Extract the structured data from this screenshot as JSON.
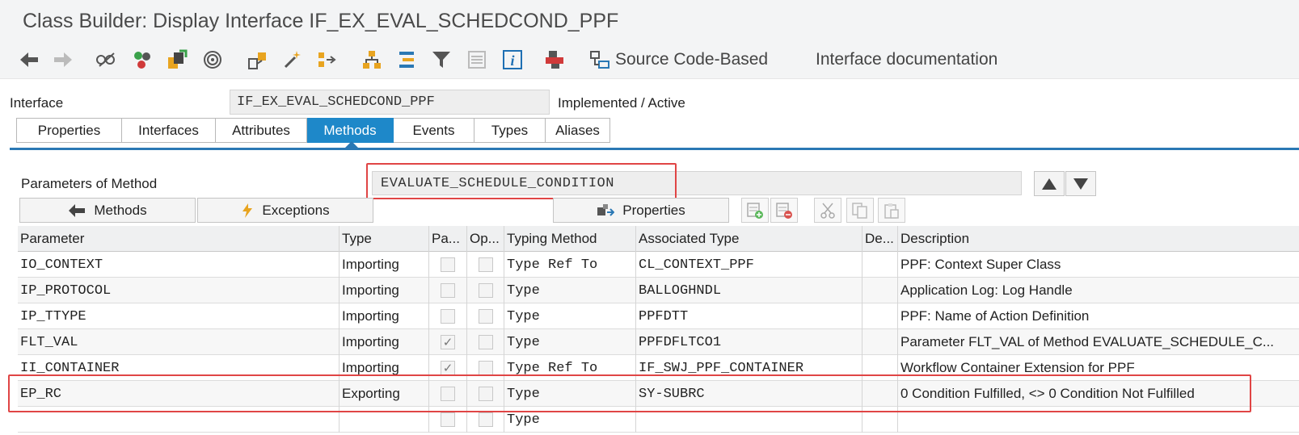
{
  "window": {
    "title": "Class Builder: Display Interface IF_EX_EVAL_SCHEDCOND_PPF"
  },
  "toolbar": {
    "icons": [
      "back-arrow-icon",
      "forward-arrow-icon",
      "display-change-icon",
      "check-icon",
      "activate-icon",
      "where-used-icon",
      "object-list-icon",
      "hierarchy-icon",
      "enhance-icon",
      "navigate-icon",
      "tree-icon",
      "filter-icon",
      "list-icon",
      "info-icon",
      "tools-icon",
      "source-icon"
    ],
    "source_code_label": "Source Code-Based",
    "documentation_label": "Interface documentation"
  },
  "interface": {
    "label": "Interface",
    "value": "IF_EX_EVAL_SCHEDCOND_PPF",
    "status": "Implemented / Active"
  },
  "tabs": [
    {
      "label": "Properties",
      "active": false
    },
    {
      "label": "Interfaces",
      "active": false
    },
    {
      "label": "Attributes",
      "active": false
    },
    {
      "label": "Methods",
      "active": true
    },
    {
      "label": "Events",
      "active": false
    },
    {
      "label": "Types",
      "active": false
    },
    {
      "label": "Aliases",
      "active": false
    }
  ],
  "method": {
    "label": "Parameters of Method",
    "value": "EVALUATE_SCHEDULE_CONDITION"
  },
  "buttons": {
    "methods": "Methods",
    "exceptions": "Exceptions",
    "properties": "Properties"
  },
  "table": {
    "headers": [
      "Parameter",
      "Type",
      "Pa...",
      "Op...",
      "Typing Method",
      "Associated Type",
      "De...",
      "Description"
    ],
    "rows": [
      {
        "parameter": "IO_CONTEXT",
        "type": "Importing",
        "pass": false,
        "optional": false,
        "typing": "Type Ref To",
        "assoc": "CL_CONTEXT_PPF",
        "desc": "PPF: Context Super Class"
      },
      {
        "parameter": "IP_PROTOCOL",
        "type": "Importing",
        "pass": false,
        "optional": false,
        "typing": "Type",
        "assoc": "BALLOGHNDL",
        "desc": "Application Log: Log Handle"
      },
      {
        "parameter": "IP_TTYPE",
        "type": "Importing",
        "pass": false,
        "optional": false,
        "typing": "Type",
        "assoc": "PPFDTT",
        "desc": "PPF: Name of Action Definition"
      },
      {
        "parameter": "FLT_VAL",
        "type": "Importing",
        "pass": true,
        "optional": false,
        "typing": "Type",
        "assoc": "PPFDFLTCO1",
        "desc": "Parameter FLT_VAL of Method EVALUATE_SCHEDULE_C..."
      },
      {
        "parameter": "II_CONTAINER",
        "type": "Importing",
        "pass": true,
        "optional": false,
        "typing": "Type Ref To",
        "assoc": "IF_SWJ_PPF_CONTAINER",
        "desc": "Workflow Container Extension for PPF"
      },
      {
        "parameter": "EP_RC",
        "type": "Exporting",
        "pass": false,
        "optional": false,
        "typing": "Type",
        "assoc": "SY-SUBRC",
        "desc": "0  Condition Fulfilled, <> 0 Condition Not Fulfilled"
      },
      {
        "parameter": "",
        "type": "",
        "pass": false,
        "optional": false,
        "typing": "Type",
        "assoc": "",
        "desc": ""
      }
    ]
  }
}
